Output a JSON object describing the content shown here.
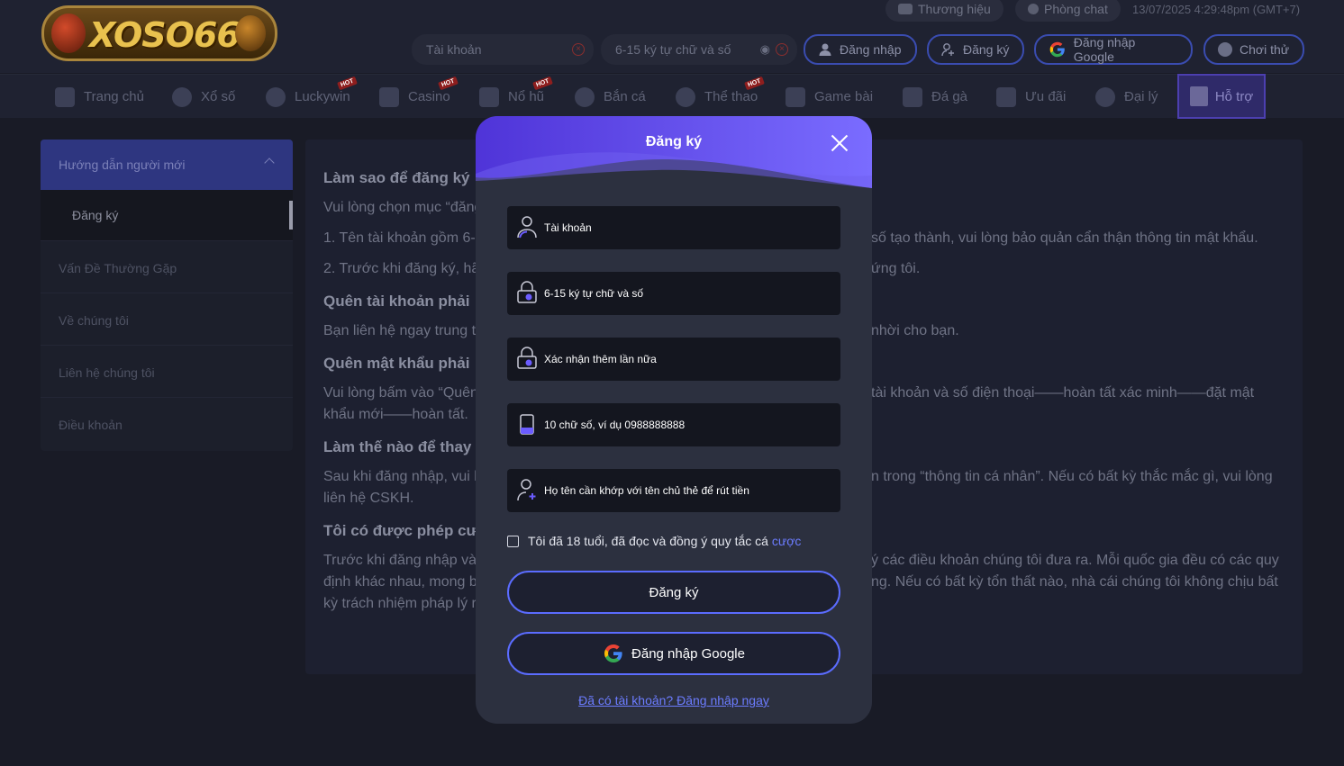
{
  "header": {
    "logo_text": "XOSO66",
    "utility": {
      "brand": "Thương hiệu",
      "chat": "Phòng chat",
      "datetime": "13/07/2025 4:29:48pm",
      "timezone": "(GMT+7)"
    },
    "account_placeholder": "Tài khoản",
    "password_placeholder": "6-15 ký tự chữ và số",
    "login_label": "Đăng nhập",
    "register_label": "Đăng ký",
    "google_label": "Đăng nhập Google",
    "trial_label": "Chơi thử"
  },
  "nav": {
    "items": [
      {
        "label": "Trang chủ",
        "hot": false
      },
      {
        "label": "Xổ số",
        "hot": false
      },
      {
        "label": "Luckywin",
        "hot": true
      },
      {
        "label": "Casino",
        "hot": true
      },
      {
        "label": "Nổ hũ",
        "hot": true
      },
      {
        "label": "Bắn cá",
        "hot": false
      },
      {
        "label": "Thể thao",
        "hot": true
      },
      {
        "label": "Game bài",
        "hot": false
      },
      {
        "label": "Đá gà",
        "hot": false
      },
      {
        "label": "Ưu đãi",
        "hot": false
      },
      {
        "label": "Đại lý",
        "hot": false
      },
      {
        "label": "Hỗ trợ",
        "hot": false
      }
    ],
    "hot_badge": "HOT",
    "active_index": 11
  },
  "sidebar": {
    "header": "Hướng dẫn người mới",
    "sub_item": "Đăng ký",
    "items": [
      "Vấn Đề Thường Gặp",
      "Về chúng tôi",
      "Liên hệ chúng tôi",
      "Điều khoản"
    ]
  },
  "content": {
    "h1": "Làm sao để đăng ký",
    "p1": "Vui lòng chọn mục “đăng",
    "p2_left": "1. Tên tài khoản gồm 6-",
    "p2_right": "số tạo thành, vui lòng bảo quản cẩn thận thông tin mật khẩu.",
    "p3_left": "2. Trước khi đăng ký, hã",
    "p3_right": "ứng tôi.",
    "h2": "Quên tài khoản phải",
    "p4_left": "Bạn liên hệ ngay trung t",
    "p4_right": "nhời cho bạn.",
    "h3": "Quên mật khẩu phải",
    "p5_left": "Vui lòng bấm vào “Quên",
    "p5_right": "tài khoản và số điện thoại——hoàn tất xác minh——đặt mật",
    "p6": "khẩu mới——hoàn tất.",
    "h4": "Làm thế nào để thay",
    "p7_left": "Sau khi đăng nhập, vui l",
    "p7_right": "n trong “thông tin cá nhân”. Nếu có bất kỳ thắc mắc gì, vui lòng",
    "p8": "liên hệ CSKH.",
    "h5": "Tôi có được phép cư",
    "p9_left": "Trước khi đăng nhập và",
    "p9_right": "ý các điều khoản chúng tôi đưa ra. Mỗi quốc gia đều có các quy",
    "p10_left": "định khác nhau, mong b",
    "p10_right": "ng. Nếu có bất kỳ tổn thất nào, nhà cái chúng tôi không chịu bất",
    "p11_left": "kỳ trách nhiệm pháp lý r"
  },
  "modal": {
    "title": "Đăng ký",
    "fields": [
      {
        "placeholder": "Tài khoản",
        "icon": "user-icon"
      },
      {
        "placeholder": "6-15 ký tự chữ và số",
        "icon": "lock-icon"
      },
      {
        "placeholder": "Xác nhận thêm lần nữa",
        "icon": "lock-icon"
      },
      {
        "placeholder": "10 chữ số, ví dụ 0988888888",
        "icon": "phone-icon"
      },
      {
        "placeholder": "Họ tên cần khớp với tên chủ thẻ để rút tiền",
        "icon": "user-add-icon"
      }
    ],
    "agree_text": "Tôi đã 18 tuổi, đã đọc và đồng ý quy tắc cá",
    "agree_link": "cược",
    "submit_label": "Đăng ký",
    "google_label": "Đăng nhập Google",
    "login_link": "Đã có tài khoản? Đăng nhập ngay"
  },
  "colors": {
    "accent": "#5b6cff",
    "modal_header_from": "#4f34d8",
    "modal_header_to": "#7a6cff",
    "link": "#6c7cff",
    "background": "#191b26"
  }
}
